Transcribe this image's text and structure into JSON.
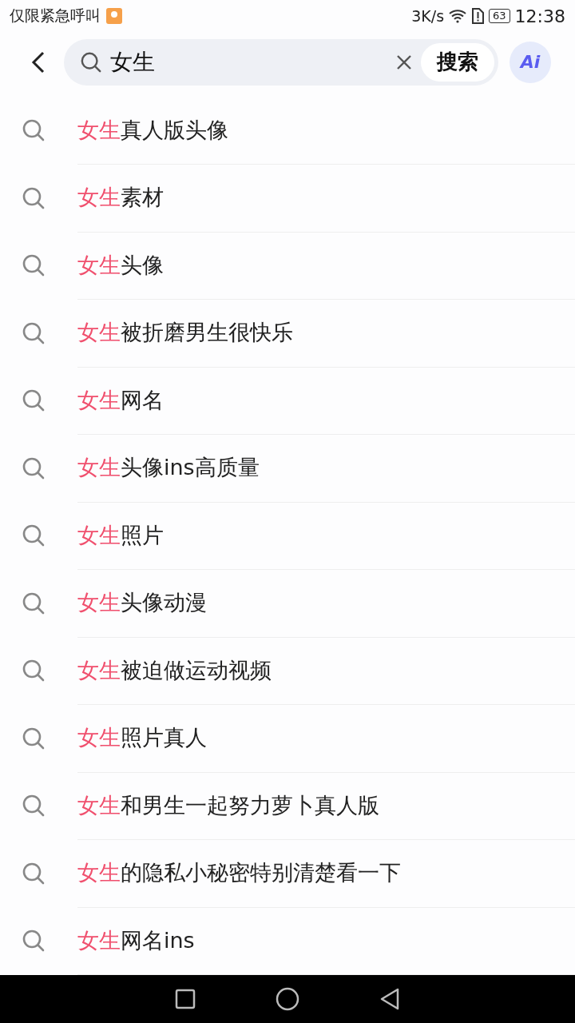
{
  "status_bar": {
    "notice": "仅限紧急呼叫",
    "speed": "3K/s",
    "battery": "63",
    "time": "12:38"
  },
  "search": {
    "value": "女生",
    "button": "搜索",
    "ai_label": "Ai"
  },
  "suggestions": [
    {
      "match": "女生",
      "rest": "真人版头像"
    },
    {
      "match": "女生",
      "rest": "素材"
    },
    {
      "match": "女生",
      "rest": "头像"
    },
    {
      "match": "女生",
      "rest": "被折磨男生很快乐"
    },
    {
      "match": "女生",
      "rest": "网名"
    },
    {
      "match": "女生",
      "rest": "头像ins高质量"
    },
    {
      "match": "女生",
      "rest": "照片"
    },
    {
      "match": "女生",
      "rest": "头像动漫"
    },
    {
      "match": "女生",
      "rest": "被迫做运动视频"
    },
    {
      "match": "女生",
      "rest": "照片真人"
    },
    {
      "match": "女生",
      "rest": "和男生一起努力萝卜真人版"
    },
    {
      "match": "女生",
      "rest": "的隐私小秘密特别清楚看一下"
    },
    {
      "match": "女生",
      "rest": "网名ins"
    }
  ]
}
